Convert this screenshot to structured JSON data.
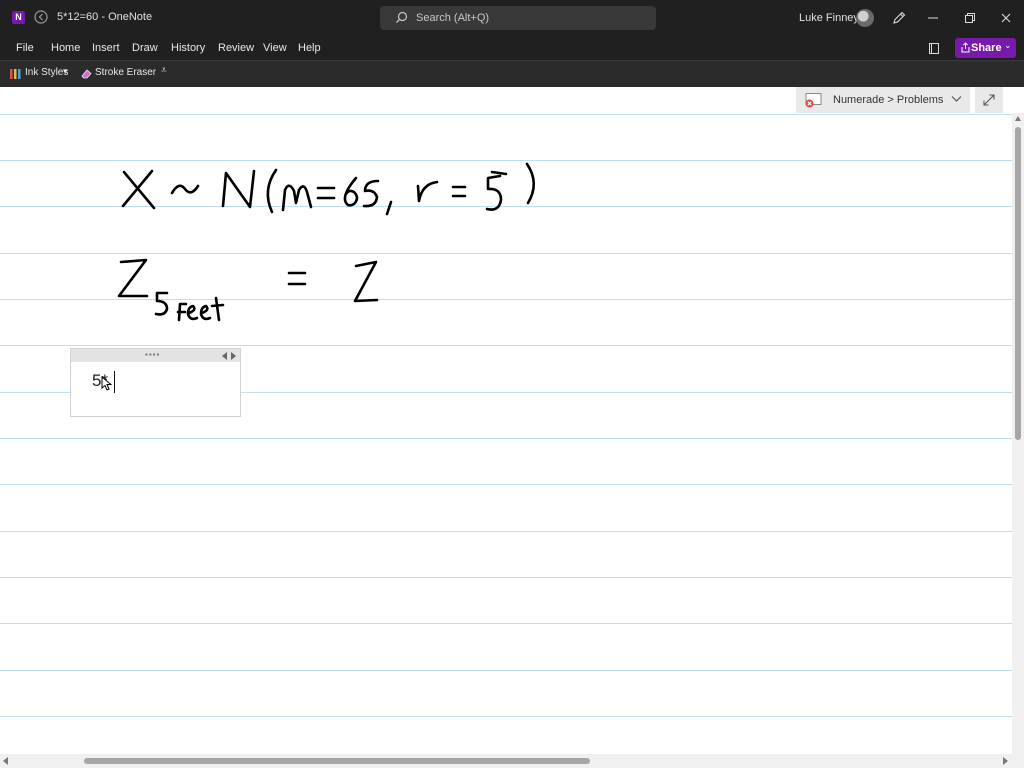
{
  "window": {
    "title": "5*12=60  -  OneNote",
    "app_icon_letter": "N",
    "user_name": "Luke Finney"
  },
  "search": {
    "placeholder": "Search (Alt+Q)"
  },
  "menu": {
    "items": [
      "File",
      "Home",
      "Insert",
      "Draw",
      "History",
      "Review",
      "View",
      "Help"
    ]
  },
  "share": {
    "label": "Share"
  },
  "ribbon": {
    "ink_styles": "Ink Styles",
    "stroke_eraser": "Stroke Eraser"
  },
  "breadcrumb": {
    "label": "Numerade > Problems"
  },
  "note": {
    "text": "5*"
  },
  "colors": {
    "titlebar": "#202020",
    "accent": "#7719aa",
    "rule_lines": "#bfe0f2",
    "ink": "#000000"
  },
  "icons": [
    "onenote-icon",
    "back-icon",
    "search-icon",
    "avatar",
    "pen-icon",
    "minimize-icon",
    "restore-icon",
    "close-icon",
    "notebooks-icon",
    "share-icon",
    "ink-styles-icon",
    "eraser-icon",
    "section-icon",
    "fullpage-icon",
    "cursor-icon"
  ]
}
